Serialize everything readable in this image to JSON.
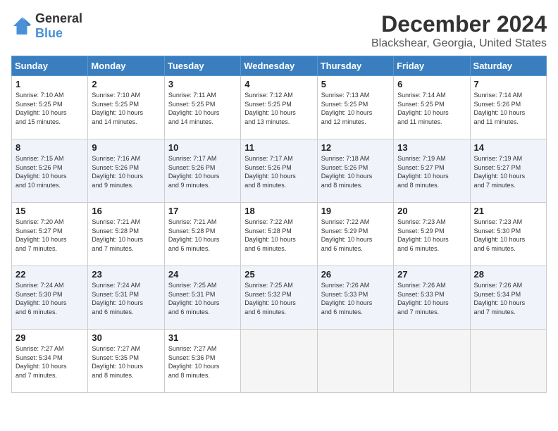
{
  "logo": {
    "general": "General",
    "blue": "Blue"
  },
  "header": {
    "month": "December 2024",
    "location": "Blackshear, Georgia, United States"
  },
  "weekdays": [
    "Sunday",
    "Monday",
    "Tuesday",
    "Wednesday",
    "Thursday",
    "Friday",
    "Saturday"
  ],
  "weeks": [
    [
      {
        "day": "1",
        "info": "Sunrise: 7:10 AM\nSunset: 5:25 PM\nDaylight: 10 hours\nand 15 minutes."
      },
      {
        "day": "2",
        "info": "Sunrise: 7:10 AM\nSunset: 5:25 PM\nDaylight: 10 hours\nand 14 minutes."
      },
      {
        "day": "3",
        "info": "Sunrise: 7:11 AM\nSunset: 5:25 PM\nDaylight: 10 hours\nand 14 minutes."
      },
      {
        "day": "4",
        "info": "Sunrise: 7:12 AM\nSunset: 5:25 PM\nDaylight: 10 hours\nand 13 minutes."
      },
      {
        "day": "5",
        "info": "Sunrise: 7:13 AM\nSunset: 5:25 PM\nDaylight: 10 hours\nand 12 minutes."
      },
      {
        "day": "6",
        "info": "Sunrise: 7:14 AM\nSunset: 5:25 PM\nDaylight: 10 hours\nand 11 minutes."
      },
      {
        "day": "7",
        "info": "Sunrise: 7:14 AM\nSunset: 5:26 PM\nDaylight: 10 hours\nand 11 minutes."
      }
    ],
    [
      {
        "day": "8",
        "info": "Sunrise: 7:15 AM\nSunset: 5:26 PM\nDaylight: 10 hours\nand 10 minutes."
      },
      {
        "day": "9",
        "info": "Sunrise: 7:16 AM\nSunset: 5:26 PM\nDaylight: 10 hours\nand 9 minutes."
      },
      {
        "day": "10",
        "info": "Sunrise: 7:17 AM\nSunset: 5:26 PM\nDaylight: 10 hours\nand 9 minutes."
      },
      {
        "day": "11",
        "info": "Sunrise: 7:17 AM\nSunset: 5:26 PM\nDaylight: 10 hours\nand 8 minutes."
      },
      {
        "day": "12",
        "info": "Sunrise: 7:18 AM\nSunset: 5:26 PM\nDaylight: 10 hours\nand 8 minutes."
      },
      {
        "day": "13",
        "info": "Sunrise: 7:19 AM\nSunset: 5:27 PM\nDaylight: 10 hours\nand 8 minutes."
      },
      {
        "day": "14",
        "info": "Sunrise: 7:19 AM\nSunset: 5:27 PM\nDaylight: 10 hours\nand 7 minutes."
      }
    ],
    [
      {
        "day": "15",
        "info": "Sunrise: 7:20 AM\nSunset: 5:27 PM\nDaylight: 10 hours\nand 7 minutes."
      },
      {
        "day": "16",
        "info": "Sunrise: 7:21 AM\nSunset: 5:28 PM\nDaylight: 10 hours\nand 7 minutes."
      },
      {
        "day": "17",
        "info": "Sunrise: 7:21 AM\nSunset: 5:28 PM\nDaylight: 10 hours\nand 6 minutes."
      },
      {
        "day": "18",
        "info": "Sunrise: 7:22 AM\nSunset: 5:28 PM\nDaylight: 10 hours\nand 6 minutes."
      },
      {
        "day": "19",
        "info": "Sunrise: 7:22 AM\nSunset: 5:29 PM\nDaylight: 10 hours\nand 6 minutes."
      },
      {
        "day": "20",
        "info": "Sunrise: 7:23 AM\nSunset: 5:29 PM\nDaylight: 10 hours\nand 6 minutes."
      },
      {
        "day": "21",
        "info": "Sunrise: 7:23 AM\nSunset: 5:30 PM\nDaylight: 10 hours\nand 6 minutes."
      }
    ],
    [
      {
        "day": "22",
        "info": "Sunrise: 7:24 AM\nSunset: 5:30 PM\nDaylight: 10 hours\nand 6 minutes."
      },
      {
        "day": "23",
        "info": "Sunrise: 7:24 AM\nSunset: 5:31 PM\nDaylight: 10 hours\nand 6 minutes."
      },
      {
        "day": "24",
        "info": "Sunrise: 7:25 AM\nSunset: 5:31 PM\nDaylight: 10 hours\nand 6 minutes."
      },
      {
        "day": "25",
        "info": "Sunrise: 7:25 AM\nSunset: 5:32 PM\nDaylight: 10 hours\nand 6 minutes."
      },
      {
        "day": "26",
        "info": "Sunrise: 7:26 AM\nSunset: 5:33 PM\nDaylight: 10 hours\nand 6 minutes."
      },
      {
        "day": "27",
        "info": "Sunrise: 7:26 AM\nSunset: 5:33 PM\nDaylight: 10 hours\nand 7 minutes."
      },
      {
        "day": "28",
        "info": "Sunrise: 7:26 AM\nSunset: 5:34 PM\nDaylight: 10 hours\nand 7 minutes."
      }
    ],
    [
      {
        "day": "29",
        "info": "Sunrise: 7:27 AM\nSunset: 5:34 PM\nDaylight: 10 hours\nand 7 minutes."
      },
      {
        "day": "30",
        "info": "Sunrise: 7:27 AM\nSunset: 5:35 PM\nDaylight: 10 hours\nand 8 minutes."
      },
      {
        "day": "31",
        "info": "Sunrise: 7:27 AM\nSunset: 5:36 PM\nDaylight: 10 hours\nand 8 minutes."
      },
      {
        "day": "",
        "info": ""
      },
      {
        "day": "",
        "info": ""
      },
      {
        "day": "",
        "info": ""
      },
      {
        "day": "",
        "info": ""
      }
    ]
  ]
}
